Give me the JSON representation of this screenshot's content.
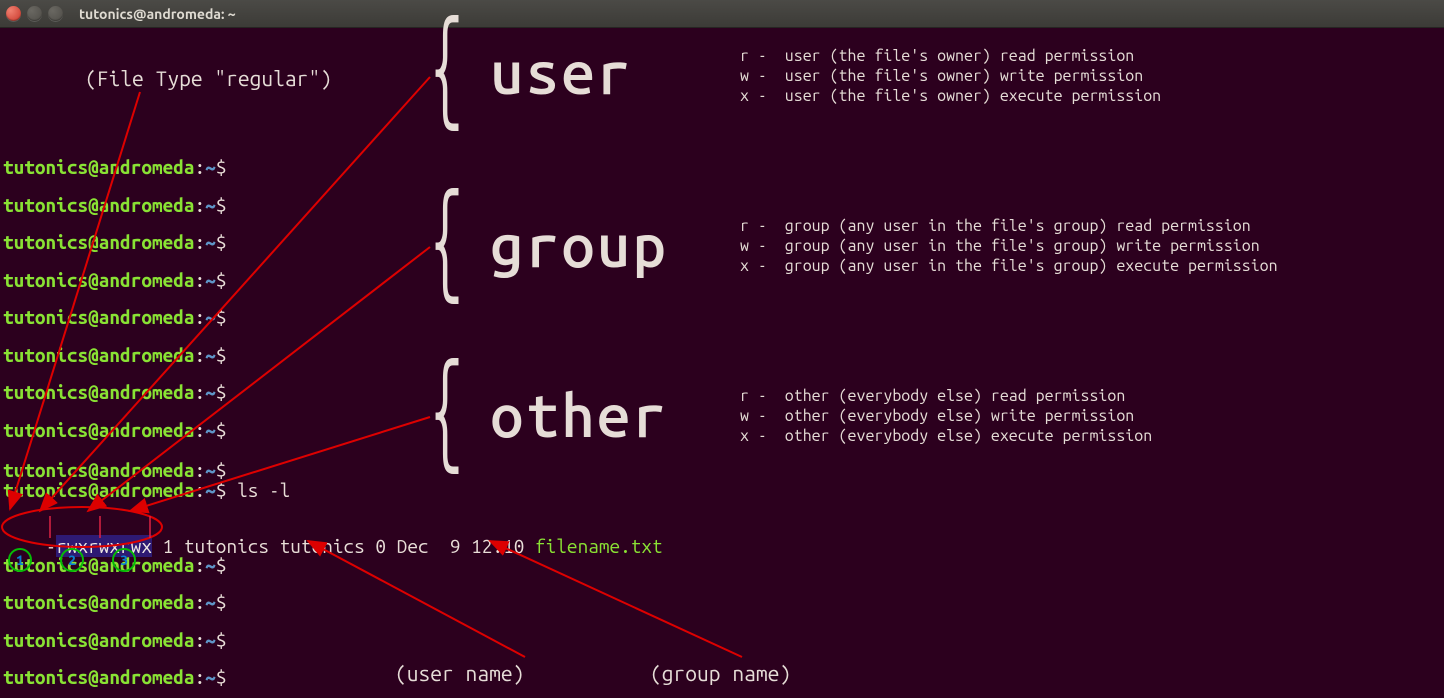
{
  "window": {
    "title": "tutonics@andromeda: ~"
  },
  "annotations": {
    "file_type": "(File Type \"regular\")",
    "user_name": "(user name)",
    "group_name": "(group name)"
  },
  "sections": {
    "user": {
      "brace": "{",
      "label": "user",
      "r": "r -  user (the file's owner) read permission",
      "w": "w -  user (the file's owner) write permission",
      "x": "x -  user (the file's owner) execute permission"
    },
    "group": {
      "brace": "{",
      "label": "group",
      "r": "r -  group (any user in the file's group) read permission",
      "w": "w -  group (any user in the file's group) write permission",
      "x": "x -  group (any user in the file's group) execute permission"
    },
    "other": {
      "brace": "{",
      "label": "other",
      "r": "r -  other (everybody else) read permission",
      "w": "w -  other (everybody else) write permission",
      "x": "x -  other (everybody else) execute permission"
    }
  },
  "badges": {
    "one": "1",
    "two": "2",
    "three": "3"
  },
  "prompts": {
    "user": "tutonics",
    "at": "@",
    "host": "andromeda",
    "colon": ":",
    "path": "~",
    "dollar": "$"
  },
  "ls": {
    "cmd": "ls -l",
    "dash": "-",
    "perm1": "rwx",
    "perm2": "rwx",
    "perm3": "rwx",
    "rest": " 1 tutonics tutonics 0 Dec  9 12:10 ",
    "filename": "filename.txt"
  }
}
